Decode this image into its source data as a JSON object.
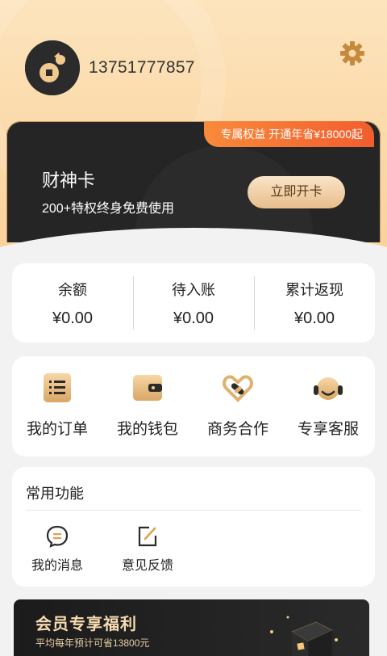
{
  "profile": {
    "phone": "13751777857"
  },
  "card": {
    "promo": "专属权益 开通年省¥18000起",
    "title": "财神卡",
    "subtitle": "200+特权终身免费使用",
    "button": "立即开卡"
  },
  "stats": [
    {
      "label": "余额",
      "value": "¥0.00"
    },
    {
      "label": "待入账",
      "value": "¥0.00"
    },
    {
      "label": "累计返现",
      "value": "¥0.00"
    }
  ],
  "quick_actions": [
    {
      "label": "我的订单",
      "icon": "order-list-icon"
    },
    {
      "label": "我的钱包",
      "icon": "wallet-icon"
    },
    {
      "label": "商务合作",
      "icon": "handshake-icon"
    },
    {
      "label": "专享客服",
      "icon": "customer-service-icon"
    }
  ],
  "common": {
    "title": "常用功能",
    "items": [
      {
        "label": "我的消息",
        "icon": "message-icon"
      },
      {
        "label": "意见反馈",
        "icon": "feedback-icon"
      }
    ]
  },
  "banner": {
    "title": "会员专享福利",
    "subtitle": "平均每年预计可省13800元"
  },
  "colors": {
    "header_top": "#fde4bd",
    "header_bottom": "#f9d19a",
    "card_bg": "#262525",
    "promo": "#f15d2e",
    "gold_accent": "#d9a664"
  }
}
